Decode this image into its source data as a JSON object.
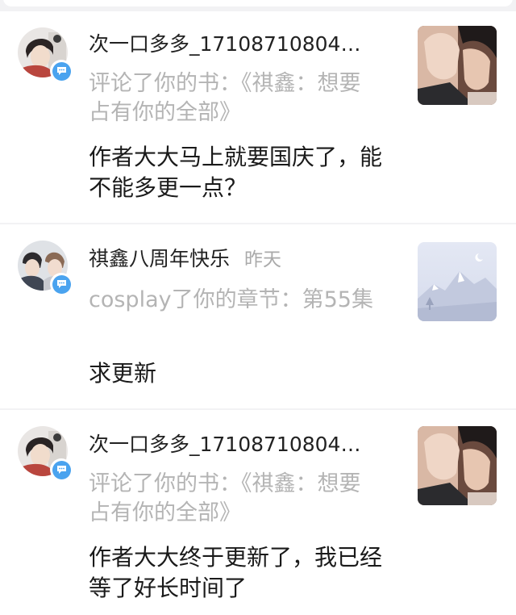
{
  "notifications": [
    {
      "user": "次一口多多_17108710804…",
      "time": "",
      "action": "评论了你的书：《祺鑫：想要占有你的全部》",
      "comment": "作者大大马上就要国庆了，能不能多更一点？",
      "thumb": "cover-photo"
    },
    {
      "user": "祺鑫八周年快乐",
      "time": "昨天",
      "action": "cosplay了你的章节：第55集",
      "comment": "求更新",
      "thumb": "default-mountain-cover"
    },
    {
      "user": "次一口多多_17108710804…",
      "time": "",
      "action": "评论了你的书：《祺鑫：想要占有你的全部》",
      "comment": "作者大大终于更新了，我已经等了好长时间了",
      "thumb": "cover-photo"
    }
  ],
  "icons": {
    "badge": "message-bubble-icon"
  },
  "colors": {
    "badge": "#4aa3ef",
    "muted": "#b4b4b4",
    "text": "#1a1a1a",
    "background": "#f2f2f4"
  }
}
